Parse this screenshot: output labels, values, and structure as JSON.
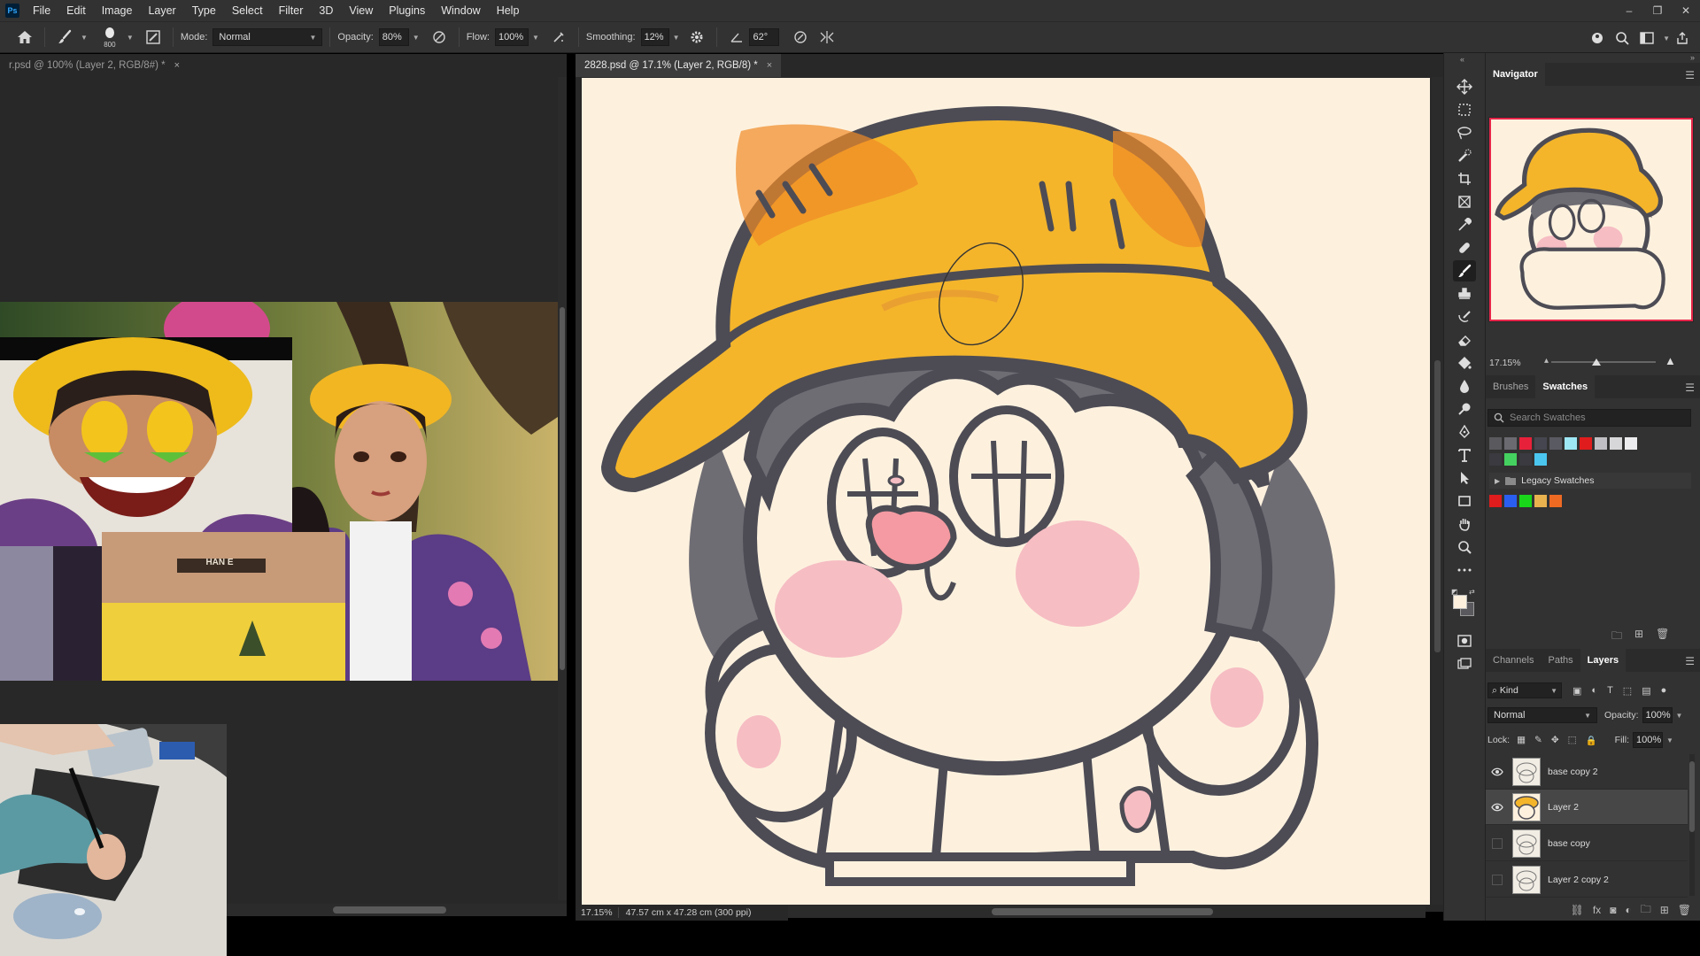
{
  "app": {
    "logo": "Ps"
  },
  "menu": [
    "File",
    "Edit",
    "Image",
    "Layer",
    "Type",
    "Select",
    "Filter",
    "3D",
    "View",
    "Plugins",
    "Window",
    "Help"
  ],
  "window_controls": {
    "minimize": "–",
    "restore": "❐",
    "close": "✕"
  },
  "options": {
    "brush_size": "800",
    "mode_label": "Mode:",
    "mode_value": "Normal",
    "opacity_label": "Opacity:",
    "opacity_value": "80%",
    "flow_label": "Flow:",
    "flow_value": "100%",
    "smoothing_label": "Smoothing:",
    "smoothing_value": "12%",
    "angle_value": "62°"
  },
  "tabs": {
    "left": {
      "label": "r.psd @ 100% (Layer 2, RGB/8#) *",
      "close": "×"
    },
    "right": {
      "label": "2828.psd @ 17.1% (Layer 2, RGB/8) *",
      "close": "×"
    }
  },
  "status": {
    "zoom": "17.15%",
    "dimensions": "47.57 cm x 47.28 cm (300 ppi)"
  },
  "navigator": {
    "title": "Navigator",
    "zoom": "17.15%"
  },
  "swatches_panel": {
    "tabs": [
      "Brushes",
      "Swatches"
    ],
    "active_tab": "Swatches",
    "search_placeholder": "Search Swatches",
    "row1": [
      "#5a5a5e",
      "#6a6a70",
      "#e8213a",
      "#464650",
      "#5a5a62",
      "#9ee8f5",
      "#e01c1c",
      "#bfbfc4",
      "#d7d7d9",
      "#ececee"
    ],
    "row2": [
      "#3a3a40",
      "#44d15f",
      "#3a3a40",
      "#4ac6ef"
    ],
    "legacy_label": "Legacy Swatches",
    "legacy_colors": [
      "#e01c1c",
      "#2a5ef0",
      "#19d61b",
      "#e9b24f",
      "#ee6a23"
    ]
  },
  "layers_panel": {
    "tabs": [
      "Channels",
      "Paths",
      "Layers"
    ],
    "active_tab": "Layers",
    "kind_label": "Kind",
    "blend_mode": "Normal",
    "opacity_label": "Opacity:",
    "opacity_value": "100%",
    "lock_label": "Lock:",
    "fill_label": "Fill:",
    "fill_value": "100%",
    "layers": [
      {
        "name": "base copy 2",
        "visible": true,
        "selected": false
      },
      {
        "name": "Layer 2",
        "visible": true,
        "selected": true
      },
      {
        "name": "base copy",
        "visible": false,
        "selected": false
      },
      {
        "name": "Layer 2 copy 2",
        "visible": false,
        "selected": false
      }
    ]
  },
  "video_overlay": {
    "box_text": "HAN E"
  },
  "icons": {
    "home": "home-icon",
    "brush": "brush-icon",
    "settings": "gear-icon",
    "search": "search-icon",
    "eye": "eye-icon",
    "folder": "folder-icon"
  }
}
